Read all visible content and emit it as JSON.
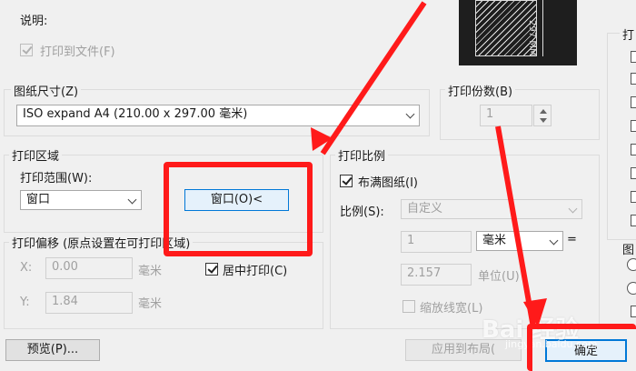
{
  "description_label": "说明:",
  "print_to_file": {
    "label": "打印到文件(F)",
    "checked": true
  },
  "preview_dim": "297 MM",
  "paper_size": {
    "title": "图纸尺寸(Z)",
    "value": "ISO expand A4 (210.00 x 297.00 毫米)"
  },
  "copies": {
    "title": "打印份数(B)",
    "value": "1"
  },
  "plot_area": {
    "title": "打印区域",
    "range_label": "打印范围(W):",
    "range_value": "窗口",
    "window_button": "窗口(O)<"
  },
  "plot_offset": {
    "title": "打印偏移 (原点设置在可打印区域)",
    "x_label": "X:",
    "x_value": "0.00",
    "x_unit": "毫米",
    "y_label": "Y:",
    "y_value": "1.84",
    "y_unit": "毫米",
    "center_label": "居中打印(C)",
    "center_checked": true
  },
  "plot_scale": {
    "title": "打印比例",
    "fit_label": "布满图纸(I)",
    "fit_checked": true,
    "scale_label": "比例(S):",
    "scale_value": "自定义",
    "value1": "1",
    "unit_value": "毫米",
    "equals": "=",
    "value2": "2.157",
    "unit_label": "单位(U)",
    "lineweights_label": "缩放线宽(L)"
  },
  "right_panel": {
    "title1": "打",
    "title2": "图"
  },
  "buttons": {
    "preview": "预览(P)...",
    "apply_layout": "应用到布局(",
    "ok": "确定"
  },
  "watermark": {
    "main": "Bai 经验",
    "sub": "jingyan.baidu.com"
  },
  "colors": {
    "accent_red": "#ff1a1a",
    "ok_border": "#0078d7"
  }
}
